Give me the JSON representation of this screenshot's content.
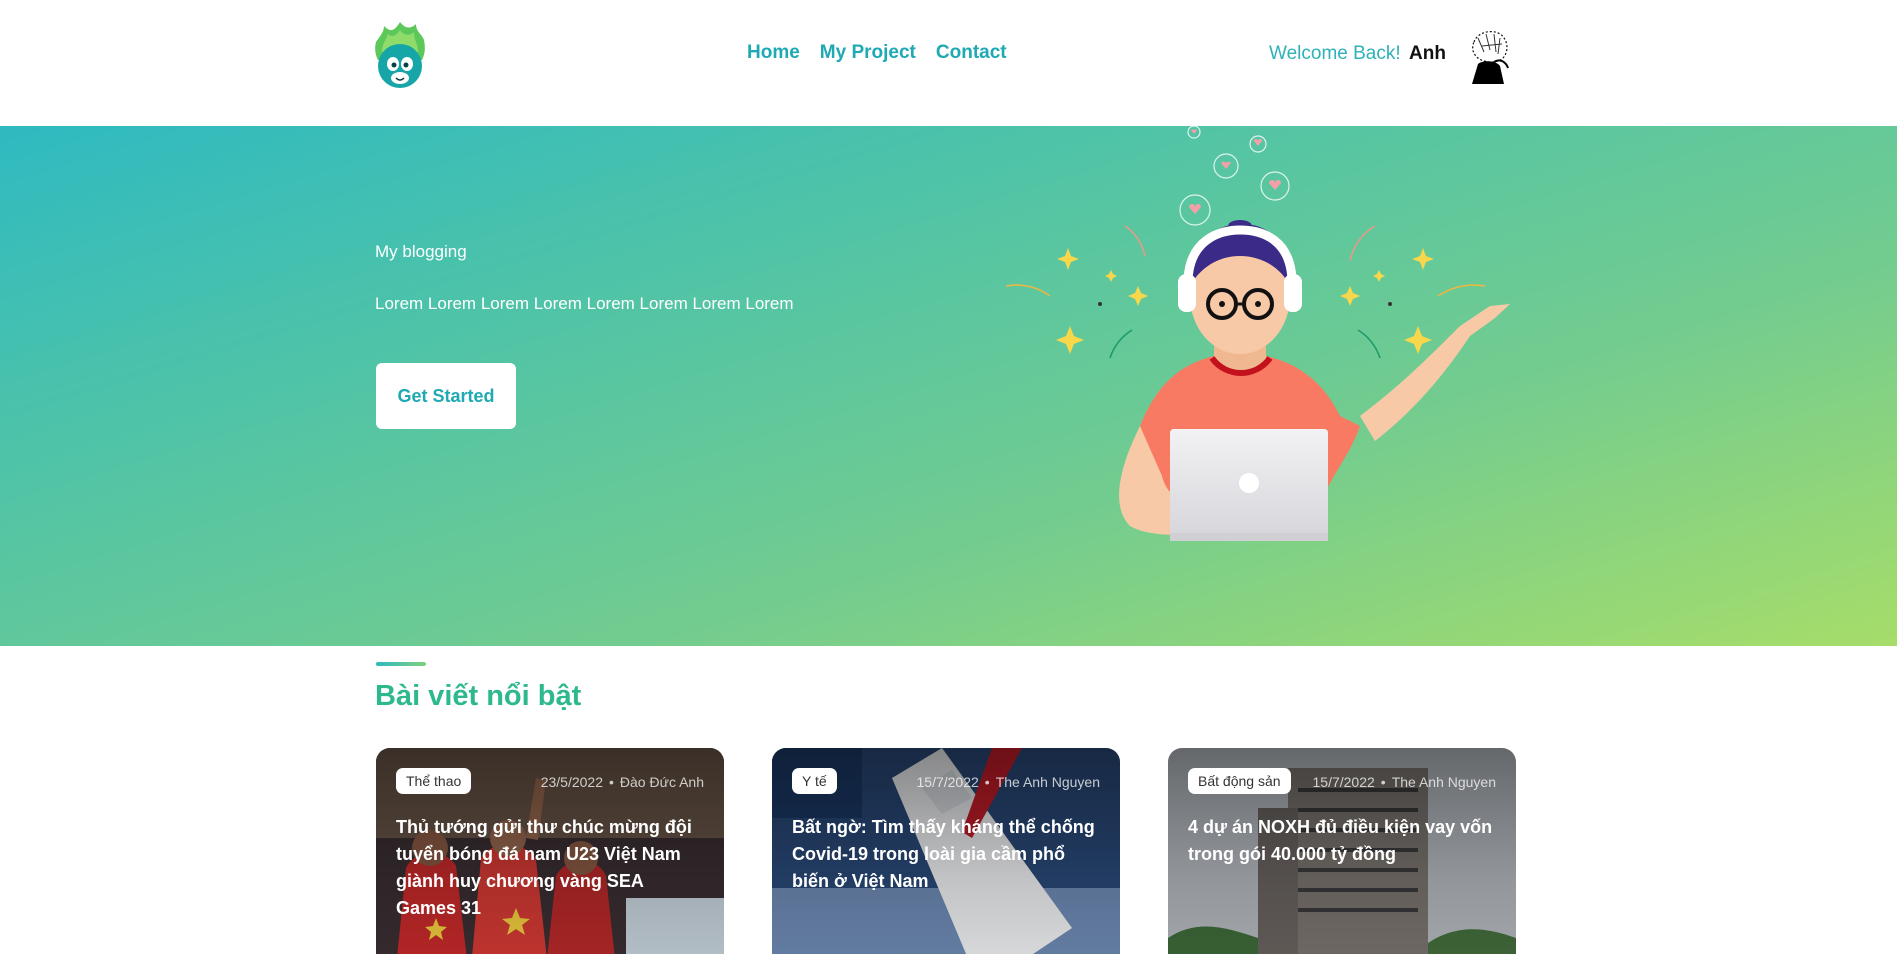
{
  "nav": {
    "items": [
      {
        "label": "Home"
      },
      {
        "label": "My Project"
      },
      {
        "label": "Contact"
      }
    ]
  },
  "user": {
    "welcome": "Welcome Back!",
    "name": "Anh"
  },
  "hero": {
    "subtitle": "My blogging",
    "text": "Lorem Lorem Lorem Lorem Lorem Lorem Lorem Lorem",
    "button_label": "Get Started"
  },
  "featured": {
    "title": "Bài viết nổi bật",
    "cards": [
      {
        "tag": "Thể thao",
        "date": "23/5/2022",
        "author": "Đào Đức Anh",
        "title": "Thủ tướng gửi thư chúc mừng đội tuyển bóng đá nam U23 Việt Nam giành huy chương vàng SEA Games 31"
      },
      {
        "tag": "Y tế",
        "date": "15/7/2022",
        "author": "The Anh Nguyen",
        "title": "Bất ngờ: Tìm thấy kháng thể chống Covid-19 trong loài gia cầm phổ biến ở Việt Nam"
      },
      {
        "tag": "Bất động sản",
        "date": "15/7/2022",
        "author": "The Anh Nguyen",
        "title": "4 dự án NOXH đủ điều kiện vay vốn trong gói 40.000 tỷ đồng"
      }
    ]
  },
  "colors": {
    "accent": "#1fa9b3",
    "section_title": "#2db88e",
    "hero_gradient_start": "#2fbac1",
    "hero_gradient_end": "#a6dd6a"
  },
  "icons": {
    "logo": "monkey-leaf-logo-icon",
    "avatar": "user-avatar-sketch"
  }
}
